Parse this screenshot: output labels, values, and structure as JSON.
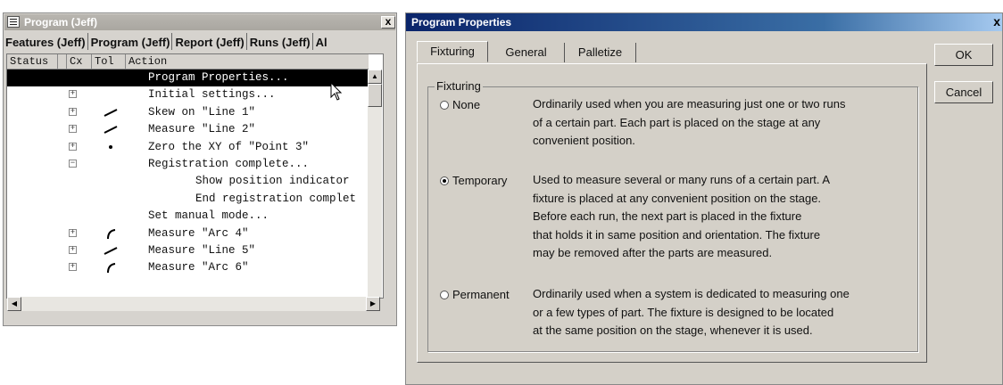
{
  "left_window": {
    "title": "Program (Jeff)",
    "close": "x",
    "tabs": [
      "Features (Jeff)",
      "Program (Jeff)",
      "Report (Jeff)",
      "Runs (Jeff)",
      "Al"
    ],
    "columns": [
      "Status",
      "Cx",
      "Tol",
      "Action"
    ],
    "rows": [
      {
        "label": "Program Properties...",
        "selected": true,
        "expander": "",
        "icon": ""
      },
      {
        "label": "Initial settings...",
        "expander": "+",
        "icon": ""
      },
      {
        "label": "Skew on \"Line 1\"",
        "expander": "+",
        "icon": "line-icon"
      },
      {
        "label": "Measure \"Line 2\"",
        "expander": "+",
        "icon": "line-icon"
      },
      {
        "label": "Zero the XY of \"Point 3\"",
        "expander": "+",
        "icon": "point-icon"
      },
      {
        "label": "Registration complete...",
        "expander": "−",
        "icon": ""
      },
      {
        "label": "Show position indicator",
        "expander": "",
        "icon": "",
        "indent": true
      },
      {
        "label": "End registration complet",
        "expander": "",
        "icon": "",
        "indent": true
      },
      {
        "label": "Set manual mode...",
        "expander": "",
        "icon": ""
      },
      {
        "label": "Measure \"Arc 4\"",
        "expander": "+",
        "icon": "arc-icon"
      },
      {
        "label": "Measure \"Line 5\"",
        "expander": "+",
        "icon": "line-icon"
      },
      {
        "label": "Measure \"Arc 6\"",
        "expander": "+",
        "icon": "arc-icon"
      }
    ]
  },
  "dialog": {
    "title": "Program Properties",
    "close": "x",
    "tabs": [
      "Fixturing",
      "General",
      "Palletize"
    ],
    "active_tab": "Fixturing",
    "group_label": "Fixturing",
    "options": [
      {
        "label": "None",
        "selected": false,
        "lines": [
          "Ordinarily used when you are measuring just one or two runs",
          "of a certain part. Each part is placed on the stage at any",
          "convenient position."
        ]
      },
      {
        "label": "Temporary",
        "selected": true,
        "lines": [
          "Used to measure several or many runs of a certain part. A",
          "fixture is placed at any convenient position on the stage.",
          "Before each run, the next part is placed in the fixture",
          "that holds it in same position and orientation. The fixture",
          "may be removed after the parts are measured."
        ]
      },
      {
        "label": "Permanent",
        "selected": false,
        "lines": [
          "Ordinarily used when a system is dedicated to measuring one",
          "or a few types of part.  The fixture is designed to be located",
          "at the same position on the stage, whenever it is used."
        ]
      }
    ],
    "ok_label": "OK",
    "cancel_label": "Cancel"
  },
  "colors": {
    "dialog_title_gradient_start": "#0a246a",
    "dialog_title_gradient_end": "#a6caf0",
    "selected_row_bg": "#000000",
    "window_face": "#d4d0c8"
  }
}
